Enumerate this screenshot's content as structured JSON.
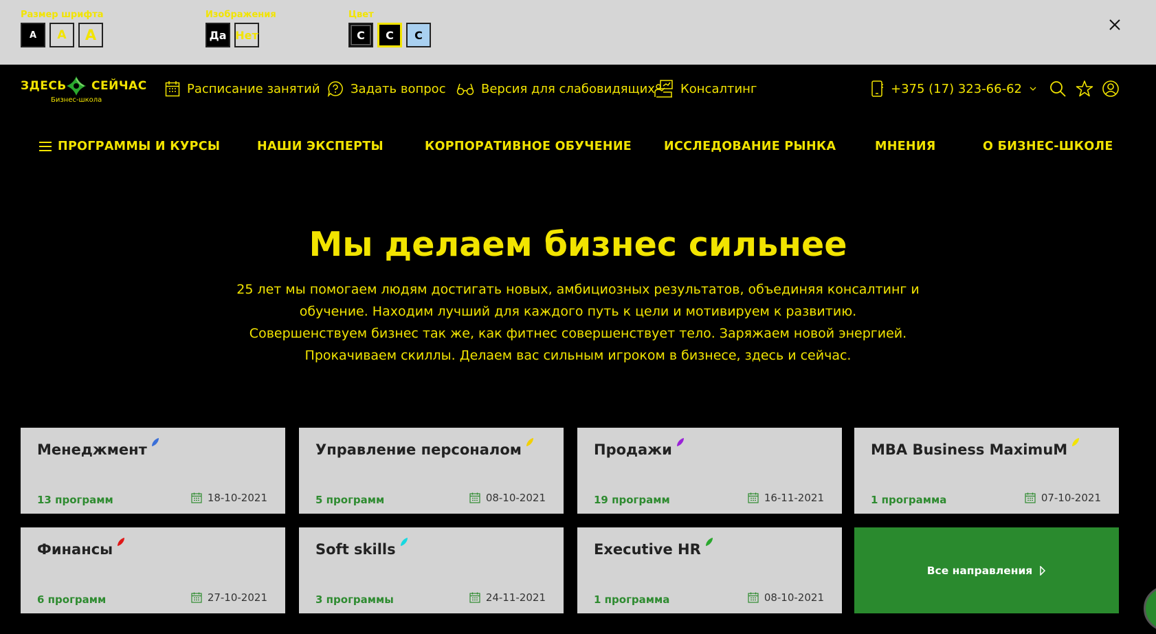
{
  "accessibility": {
    "font_size_label": "Размер шрифта",
    "font_size_options": [
      "A",
      "A",
      "A"
    ],
    "images_label": "Изображения",
    "images_yes": "Да",
    "images_no": "Нет",
    "color_label": "Цвет",
    "color_options": [
      "C",
      "C",
      "C"
    ]
  },
  "header": {
    "logo_left": "ЗДЕСЬ",
    "logo_right": "СЕЙЧАС",
    "logo_sub": "Бизнес-школа",
    "links": {
      "schedule": "Расписание занятий",
      "ask": "Задать вопрос",
      "low_vision": "Версия для слабовидящих",
      "consulting": "Консалтинг"
    },
    "phone": "+375 (17) 323-66-62"
  },
  "nav": {
    "programs": "ПРОГРАММЫ И КУРСЫ",
    "experts": "НАШИ ЭКСПЕРТЫ",
    "corporate": "КОРПОРАТИВНОЕ ОБУЧЕНИЕ",
    "research": "ИССЛЕДОВАНИЕ РЫНКА",
    "opinions": "МНЕНИЯ",
    "about": "О БИЗНЕС-ШКОЛЕ"
  },
  "hero": {
    "title": "Мы делаем бизнес сильнее",
    "lines": [
      "25 лет мы помогаем людям достигать новых, амбициозных результатов, объединяя консалтинг и",
      "обучение. Находим лучший для каждого путь к цели и мотивируем к развитию.",
      "Совершенствуем бизнес так же, как фитнес совершенствует тело. Заряжаем новой энергией.",
      "Прокачиваем скиллы. Делаем вас сильным игроком в бизнесе, здесь и сейчас."
    ]
  },
  "cards": [
    {
      "title": "Менеджмент",
      "count": "13 программ",
      "date": "18-10-2021",
      "leaf_color": "#3a6fd8"
    },
    {
      "title": "Управление персоналом",
      "count": "5 программ",
      "date": "08-10-2021",
      "leaf_color": "#f2d000"
    },
    {
      "title": "Продажи",
      "count": "19 программ",
      "date": "16-11-2021",
      "leaf_color": "#9a22d8"
    },
    {
      "title": "MBA Business MaximuM",
      "count": "1 программа",
      "date": "07-10-2021",
      "leaf_color": "#f2e400"
    },
    {
      "title": "Финансы",
      "count": "6 программ",
      "date": "27-10-2021",
      "leaf_color": "#e01818"
    },
    {
      "title": "Soft skills",
      "count": "3 программы",
      "date": "24-11-2021",
      "leaf_color": "#18d8e0"
    },
    {
      "title": "Executive HR",
      "count": "1 программа",
      "date": "08-10-2021",
      "leaf_color": "#2aa82e"
    }
  ],
  "all_directions": "Все направления",
  "colors": {
    "accent": "#f2e400",
    "green": "#2a8a2e",
    "card_bg": "#d3d3d3",
    "panel_bg": "#d6d6d6"
  }
}
